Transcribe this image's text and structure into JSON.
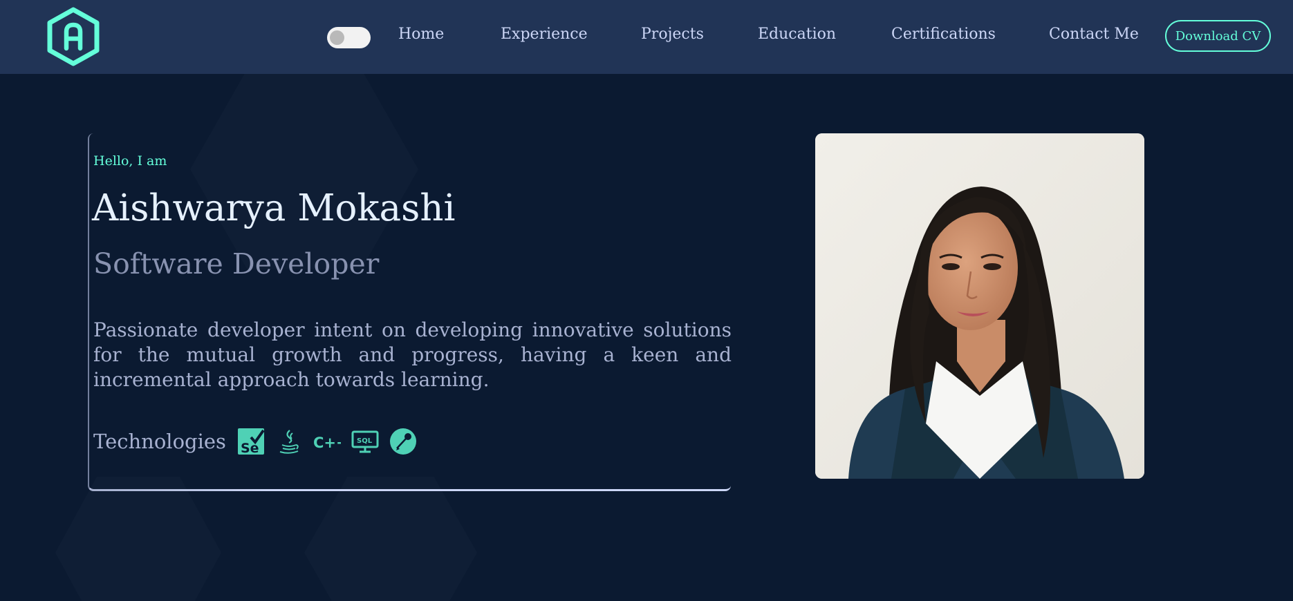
{
  "brand": {
    "logo_letter": "A",
    "accent_color": "#64ffda",
    "logo_icon": "hexagon-logo-icon"
  },
  "header": {
    "theme_toggle": "light-dark-toggle",
    "nav": [
      {
        "label": "Home"
      },
      {
        "label": "Experience"
      },
      {
        "label": "Projects"
      },
      {
        "label": "Education"
      },
      {
        "label": "Certifications"
      },
      {
        "label": "Contact Me"
      }
    ],
    "cta_label": "Download CV"
  },
  "hero": {
    "greeting": "Hello, I am",
    "name": "Aishwarya Mokashi",
    "role": "Software Developer",
    "bio": "Passionate developer intent on developing innovative solutions for the mutual growth and progress, having a keen and incremental approach towards learning.",
    "technologies_label": "Technologies",
    "technologies": [
      {
        "icon": "selenium-icon",
        "text": "Se"
      },
      {
        "icon": "java-icon"
      },
      {
        "icon": "cpp-icon",
        "text": "C++"
      },
      {
        "icon": "sql-icon",
        "text": "SQL"
      },
      {
        "icon": "postman-icon"
      }
    ]
  },
  "photo": {
    "icon": "profile-photo"
  },
  "colors": {
    "background": "#0b1a31",
    "header": "#213456",
    "text_primary": "#e6f1ff",
    "text_secondary": "#8892b0",
    "nav_text": "#ccd6f6"
  }
}
